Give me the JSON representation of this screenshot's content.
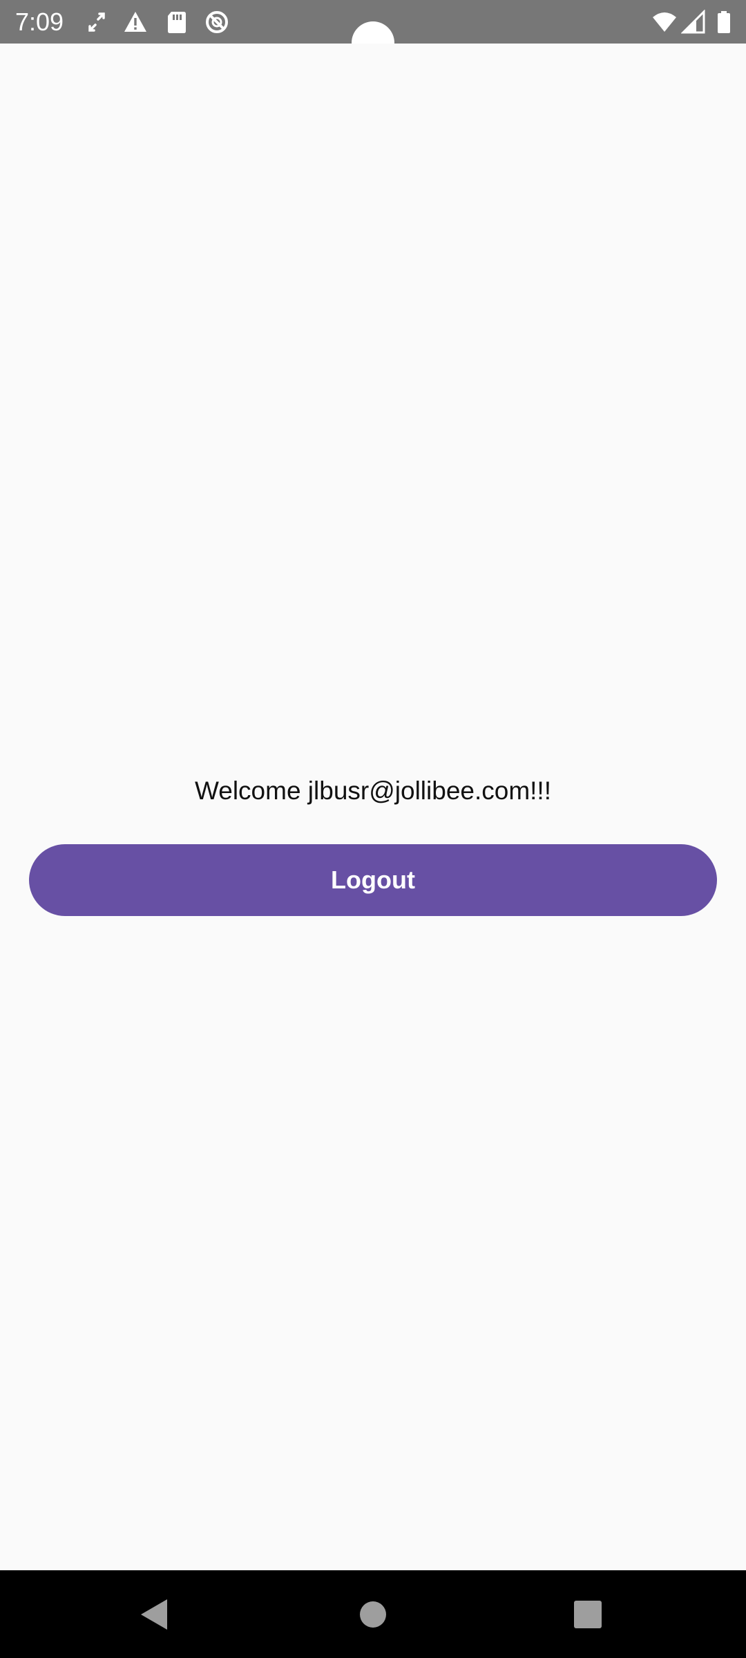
{
  "status_bar": {
    "time": "7:09",
    "left_icons": [
      "data-sync-icon",
      "warning-icon",
      "sd-card-icon",
      "do-not-disturb-icon"
    ],
    "right_icons": [
      "wifi-icon",
      "cellular-signal-icon",
      "battery-icon"
    ],
    "background_color": "#777777"
  },
  "main": {
    "welcome_text": "Welcome jlbusr@jollibee.com!!!",
    "logout_label": "Logout",
    "accent_color": "#6750a4",
    "background_color": "#fafafa"
  },
  "navigation_bar": {
    "buttons": [
      "back-icon",
      "home-icon",
      "recents-icon"
    ]
  }
}
